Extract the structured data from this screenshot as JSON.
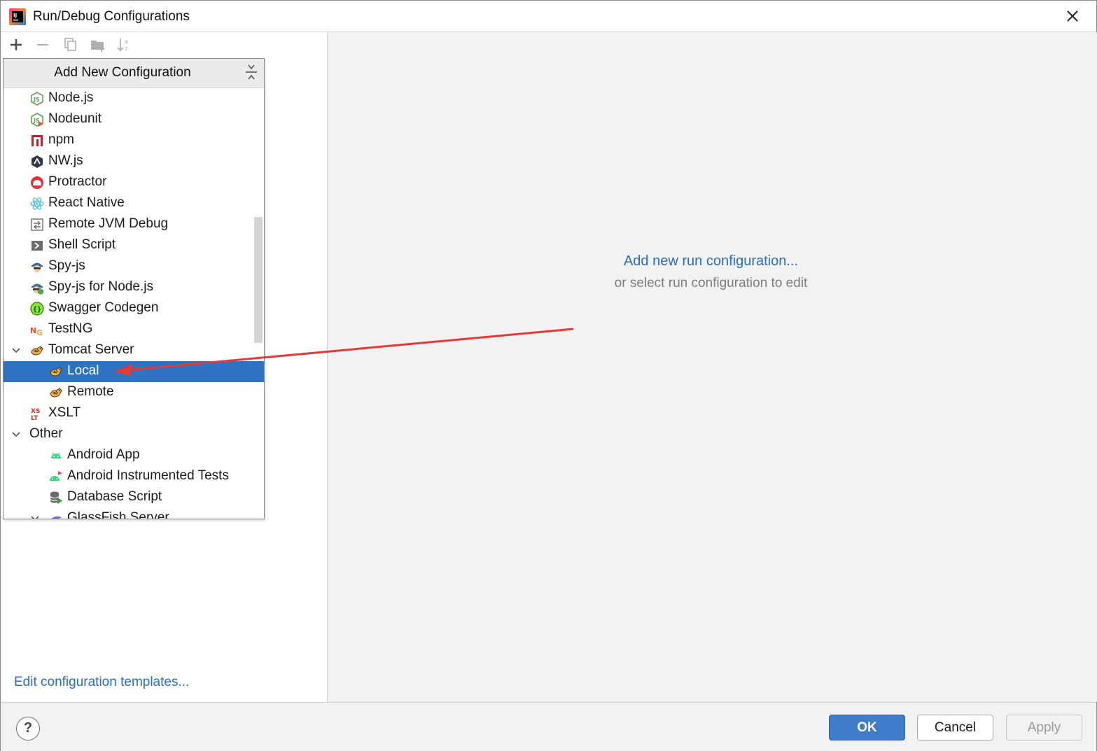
{
  "window": {
    "title": "Run/Debug Configurations"
  },
  "popup": {
    "title": "Add New Configuration",
    "items": [
      {
        "label": "Node.js",
        "icon": "nodejs-icon",
        "level": 1
      },
      {
        "label": "Nodeunit",
        "icon": "nodeunit-icon",
        "level": 1
      },
      {
        "label": "npm",
        "icon": "npm-icon",
        "level": 1
      },
      {
        "label": "NW.js",
        "icon": "nwjs-icon",
        "level": 1
      },
      {
        "label": "Protractor",
        "icon": "protractor-icon",
        "level": 1
      },
      {
        "label": "React Native",
        "icon": "react-icon",
        "level": 1
      },
      {
        "label": "Remote JVM Debug",
        "icon": "remote-debug-icon",
        "level": 1
      },
      {
        "label": "Shell Script",
        "icon": "shell-script-icon",
        "level": 1
      },
      {
        "label": "Spy-js",
        "icon": "spy-js-icon",
        "level": 1
      },
      {
        "label": "Spy-js for Node.js",
        "icon": "spy-js-node-icon",
        "level": 1
      },
      {
        "label": "Swagger Codegen",
        "icon": "swagger-icon",
        "level": 1
      },
      {
        "label": "TestNG",
        "icon": "testng-icon",
        "level": 1
      },
      {
        "label": "Tomcat Server",
        "icon": "tomcat-icon",
        "level": 1,
        "expanded": true
      },
      {
        "label": "Local",
        "icon": "tomcat-icon",
        "level": 2,
        "selected": true
      },
      {
        "label": "Remote",
        "icon": "tomcat-icon",
        "level": 2
      },
      {
        "label": "XSLT",
        "icon": "xslt-icon",
        "level": 1
      },
      {
        "label": "Other",
        "icon": "",
        "level": 0,
        "expanded": true
      },
      {
        "label": "Android App",
        "icon": "android-icon",
        "level": 2
      },
      {
        "label": "Android Instrumented Tests",
        "icon": "android-test-icon",
        "level": 2
      },
      {
        "label": "Database Script",
        "icon": "database-script-icon",
        "level": 2
      },
      {
        "label": "GlassFish Server",
        "icon": "glassfish-icon",
        "level": 2,
        "expanded": true
      }
    ]
  },
  "left": {
    "edit_templates": "Edit configuration templates..."
  },
  "right": {
    "add_link": "Add new run configuration...",
    "hint": "or select run configuration to edit"
  },
  "buttons": {
    "help": "?",
    "ok": "OK",
    "cancel": "Cancel",
    "apply": "Apply"
  },
  "colors": {
    "selection": "#2d73c2",
    "link": "#2b6db8",
    "arrow": "#e53935"
  }
}
